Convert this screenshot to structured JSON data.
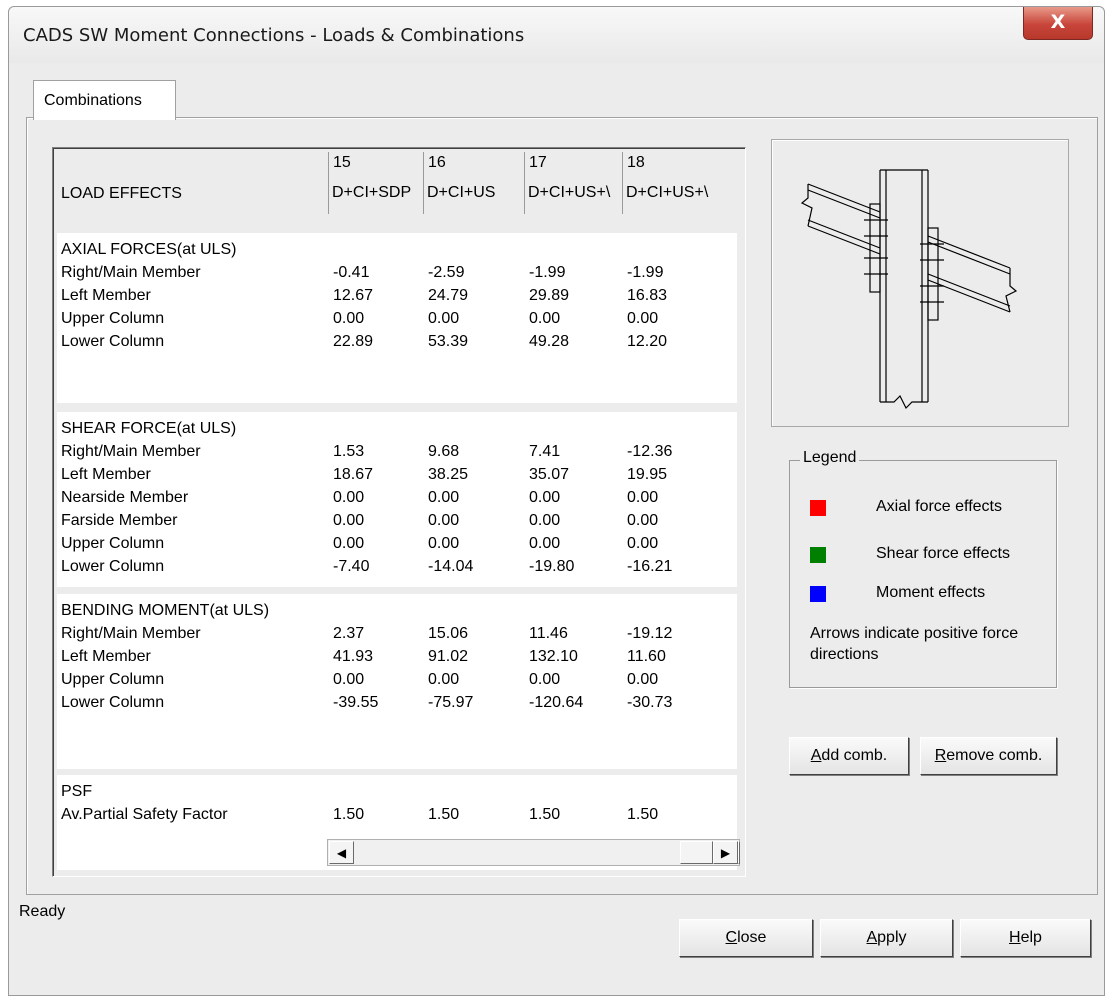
{
  "window": {
    "title": "CADS SW Moment Connections - Loads & Combinations",
    "close_label": "X"
  },
  "tabs": [
    {
      "label": "Combinations"
    }
  ],
  "grid": {
    "header_label": "LOAD EFFECTS",
    "columns": [
      {
        "number": "15",
        "combo": "D+CI+SDP"
      },
      {
        "number": "16",
        "combo": "D+CI+US"
      },
      {
        "number": "17",
        "combo": "D+CI+US+\\"
      },
      {
        "number": "18",
        "combo": "D+CI+US+\\"
      }
    ],
    "sections": [
      {
        "title": "AXIAL FORCES(at ULS)",
        "rows": [
          {
            "label": "Right/Main Member",
            "values": [
              "-0.41",
              "-2.59",
              "-1.99",
              "-1.99"
            ]
          },
          {
            "label": "Left Member",
            "values": [
              "12.67",
              "24.79",
              "29.89",
              "16.83"
            ]
          },
          {
            "label": "Upper Column",
            "values": [
              "0.00",
              "0.00",
              "0.00",
              "0.00"
            ]
          },
          {
            "label": "Lower Column",
            "values": [
              "22.89",
              "53.39",
              "49.28",
              "12.20"
            ]
          }
        ]
      },
      {
        "title": "SHEAR FORCE(at ULS)",
        "rows": [
          {
            "label": "Right/Main Member",
            "values": [
              "1.53",
              "9.68",
              "7.41",
              "-12.36"
            ]
          },
          {
            "label": "Left Member",
            "values": [
              "18.67",
              "38.25",
              "35.07",
              "19.95"
            ]
          },
          {
            "label": "Nearside Member",
            "values": [
              "0.00",
              "0.00",
              "0.00",
              "0.00"
            ]
          },
          {
            "label": "Farside Member",
            "values": [
              "0.00",
              "0.00",
              "0.00",
              "0.00"
            ]
          },
          {
            "label": "Upper Column",
            "values": [
              "0.00",
              "0.00",
              "0.00",
              "0.00"
            ]
          },
          {
            "label": "Lower Column",
            "values": [
              "-7.40",
              "-14.04",
              "-19.80",
              "-16.21"
            ]
          }
        ]
      },
      {
        "title": "BENDING MOMENT(at ULS)",
        "rows": [
          {
            "label": "Right/Main Member",
            "values": [
              "2.37",
              "15.06",
              "11.46",
              "-19.12"
            ]
          },
          {
            "label": "Left Member",
            "values": [
              "41.93",
              "91.02",
              "132.10",
              "11.60"
            ]
          },
          {
            "label": "Upper Column",
            "values": [
              "0.00",
              "0.00",
              "0.00",
              "0.00"
            ]
          },
          {
            "label": "Lower Column",
            "values": [
              "-39.55",
              "-75.97",
              "-120.64",
              "-30.73"
            ]
          }
        ]
      },
      {
        "title": "PSF",
        "rows": [
          {
            "label": "Av.Partial Safety Factor",
            "values": [
              "1.50",
              "1.50",
              "1.50",
              "1.50"
            ]
          }
        ]
      }
    ]
  },
  "legend": {
    "title": "Legend",
    "items": [
      {
        "label": "Axial force effects",
        "color": "#ff0000"
      },
      {
        "label": "Shear force effects",
        "color": "#008000"
      },
      {
        "label": "Moment effects",
        "color": "#0000ff"
      }
    ],
    "note": "Arrows indicate positive force directions"
  },
  "buttons": {
    "add_prefix": "A",
    "add_rest": "dd comb.",
    "remove_prefix": "R",
    "remove_rest": "emove comb.",
    "close_prefix": "C",
    "close_rest": "lose",
    "apply_prefix": "A",
    "apply_rest": "pply",
    "help_prefix": "H",
    "help_rest": "elp"
  },
  "status": "Ready"
}
